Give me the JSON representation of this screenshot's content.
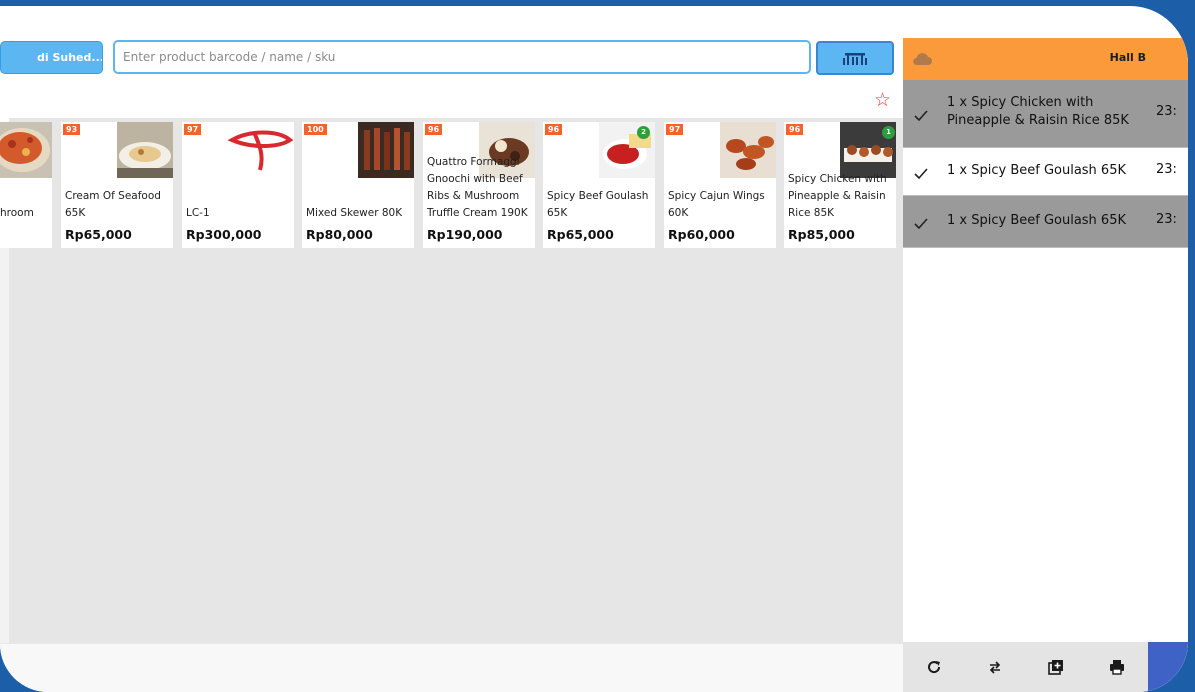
{
  "toolbar": {
    "customer_label": "di Suhed...",
    "search_placeholder": "Enter product barcode / name / sku"
  },
  "favorites": {
    "icon": "star-outline-icon"
  },
  "products": [
    {
      "badge": "",
      "name": "hroom",
      "price": "",
      "thumb": "pizza"
    },
    {
      "badge": "93",
      "name": "Cream Of Seafood 65K",
      "price": "Rp65,000",
      "thumb": "soup"
    },
    {
      "badge": "97",
      "name": "LC-1",
      "price": "Rp300,000",
      "thumb": "logo"
    },
    {
      "badge": "100",
      "name": "Mixed Skewer 80K",
      "price": "Rp80,000",
      "thumb": "skewer"
    },
    {
      "badge": "96",
      "name": "Quattro Formaggi Gnoochi with Beef Ribs & Mushroom Truffle Cream 190K",
      "price": "Rp190,000",
      "thumb": "ribs"
    },
    {
      "badge": "96",
      "name": "Spicy Beef Goulash 65K",
      "price": "Rp65,000",
      "thumb": "goulash",
      "stock": "2"
    },
    {
      "badge": "97",
      "name": "Spicy Cajun Wings 60K",
      "price": "Rp60,000",
      "thumb": "wings"
    },
    {
      "badge": "96",
      "name": "Spicy Chicken with Pineapple & Raisin Rice 85K",
      "price": "Rp85,000",
      "thumb": "chicken",
      "stock": "1"
    }
  ],
  "order": {
    "hall": "Hall B",
    "items": [
      {
        "text": "1 x Spicy Chicken with Pineapple & Raisin Rice 85K",
        "time": "23:",
        "sent": true
      },
      {
        "text": "1 x Spicy Beef Goulash 65K",
        "time": "23:",
        "sent": false
      },
      {
        "text": "1 x Spicy Beef Goulash 65K",
        "time": "23:",
        "sent": true
      }
    ]
  },
  "footer_tools": [
    "refresh-icon",
    "swap-icon",
    "add-copy-icon",
    "print-icon"
  ],
  "colors": {
    "accent_blue": "#5cb6f1",
    "header_orange": "#fb9a3a",
    "badge_orange": "#f4632d",
    "frame_blue": "#1c5ea8"
  }
}
